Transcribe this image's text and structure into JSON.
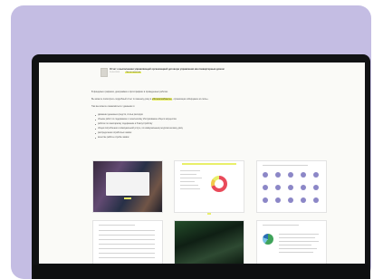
{
  "document": {
    "title": "Отчет о выполнении управляющей организацией договора управления многоквартирным домом",
    "date": "20.04.2024",
    "tag": "Лента новостей"
  },
  "body": {
    "intro": "В фондовых графиках, диаграммах и фотографиях в приведенных работах.",
    "paragraph_prefix": "Вы можете посмотреть подробный отчет по вашему дому в",
    "paragraph_link": "«Личном кабинете»",
    "paragraph_suffix": ", организации «Мерцание ал-пиль».",
    "lead": "Там вы можете ознакомиться с данными о:",
    "items": [
      "движении денежных средств, статьи расходов",
      "объеме работ по содержанию и техническому обслуживанию общего имущества",
      "работах по санитарному содержанию и благоустройству",
      "общем потреблении и коммунальной услуге, по коммунальным ресурсам на вашу дому",
      "распределении отработных заявок",
      "качестве работы службы заявок"
    ]
  },
  "thumbnails": [
    {
      "name": "report-slide-cover"
    },
    {
      "name": "report-slide-chart"
    },
    {
      "name": "report-slide-icons"
    },
    {
      "name": "report-slide-table"
    },
    {
      "name": "report-slide-photo"
    },
    {
      "name": "report-slide-pie"
    }
  ],
  "colors": {
    "card_background": "#c4bde3",
    "accent": "#e9ef6a",
    "laptop_frame": "#111214"
  }
}
